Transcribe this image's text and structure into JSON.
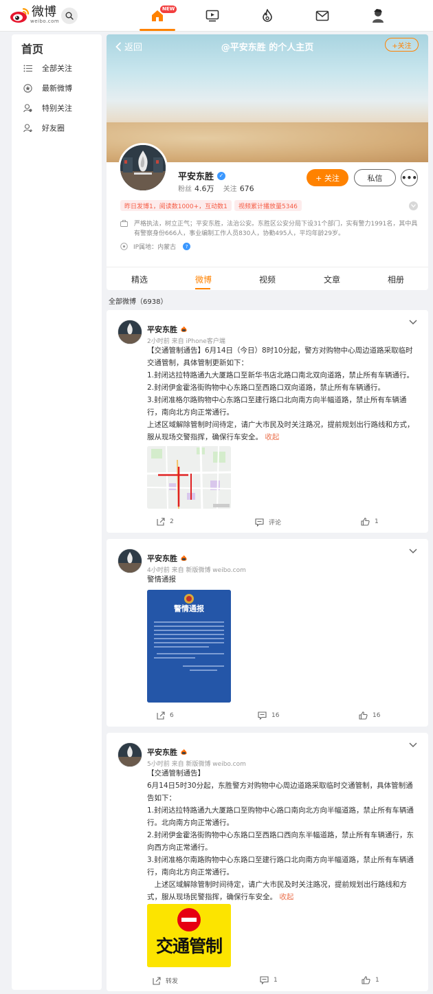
{
  "topbar": {
    "logo_text": "微博",
    "logo_sub": "weibo.com",
    "new_badge": "NEW"
  },
  "sidebar": {
    "title": "首页",
    "items": [
      {
        "label": "全部关注",
        "icon": "list-icon"
      },
      {
        "label": "最新微博",
        "icon": "latest-icon"
      },
      {
        "label": "特别关注",
        "icon": "special-follow-icon"
      },
      {
        "label": "好友圈",
        "icon": "friends-icon"
      }
    ]
  },
  "profile": {
    "back_label": "返回",
    "header_title": "@平安东胜 的个人主页",
    "follow_small": "+关注",
    "name": "平安东胜",
    "fans_label": "粉丝",
    "fans_value": "4.6万",
    "follow_label": "关注",
    "follow_value": "676",
    "follow_btn": "+ 关注",
    "message_btn": "私信",
    "more_btn": "•••",
    "pill_1": "昨日发博1，阅读数1000+，互动数1",
    "pill_2": "视频累计播放量5346",
    "bio": "严格执法，树立正气；平安东胜，法治公安。东胜区公安分局下设31个部门，实有警力1991名，其中具有警察身份666人，事业编制工作人员830人，协勤495人，平均年龄29岁。",
    "ip_label": "IP属地：内蒙古",
    "ip_help": "?",
    "tabs": [
      "精选",
      "微博",
      "视频",
      "文章",
      "相册"
    ],
    "active_tab": "微博"
  },
  "feed": {
    "count_label": "全部微博（6938）"
  },
  "posts": [
    {
      "author": "平安东胜",
      "meta": "2小时前  来自 iPhone客户端",
      "lines": [
        "【交通管制通告】6月14日（今日）8时10分起，警方对购物中心周边道路采取临时交通管制，具体管制更新如下：",
        "1.封闭达拉特路通九大厦路口至新华书店北路口南北双向道路，禁止所有车辆通行。",
        "2.封闭伊金霍洛街购物中心东路口至西路口双向道路，禁止所有车辆通行。",
        "3.封闭准格尔路购物中心东路口至建行路口北向南方向半幅道路，禁止所有车辆通行，南向北方向正常通行。",
        "上述区域解除管制时间待定，请广大市民及时关注路况，提前规划出行路线和方式，服从现场交警指挥，确保行车安全。"
      ],
      "collapse": "收起",
      "repost": "2",
      "comment": "评论",
      "like": "1"
    },
    {
      "author": "平安东胜",
      "meta": "4小时前  来自 新版微博 weibo.com",
      "lines": [
        "警情通报"
      ],
      "image_title": "警情通报",
      "repost": "6",
      "comment": "16",
      "like": "16"
    },
    {
      "author": "平安东胜",
      "meta": "5小时前  来自 新版微博 weibo.com",
      "lines": [
        "【交通管制通告】",
        "6月14日5时30分起，东胜警方对购物中心周边道路采取临时交通管制，具体管制通告如下：",
        "1.封闭达拉特路通九大厦路口至购物中心路口南向北方向半幅道路，禁止所有车辆通行。北向南方向正常通行。",
        "2.封闭伊金霍洛街购物中心东路口至西路口西向东半幅道路，禁止所有车辆通行，东向西方向正常通行。",
        "3.封闭准格尔南路购物中心东路口至建行路口北向南方向半幅道路，禁止所有车辆通行，南向北方向正常通行。",
        "　上述区域解除管制时间待定，请广大市民及时关注路况，提前规划出行路线和方式，服从现场民警指挥，确保行车安全。"
      ],
      "collapse": "收起",
      "image_title": "交通管制",
      "repost": "转发",
      "comment": "1",
      "like": "1"
    }
  ],
  "colors": {
    "accent": "#ff8200",
    "link": "#eb7350",
    "police_blue": "#2456a8",
    "sign_yellow": "#fce400",
    "sign_red": "#e60012"
  }
}
